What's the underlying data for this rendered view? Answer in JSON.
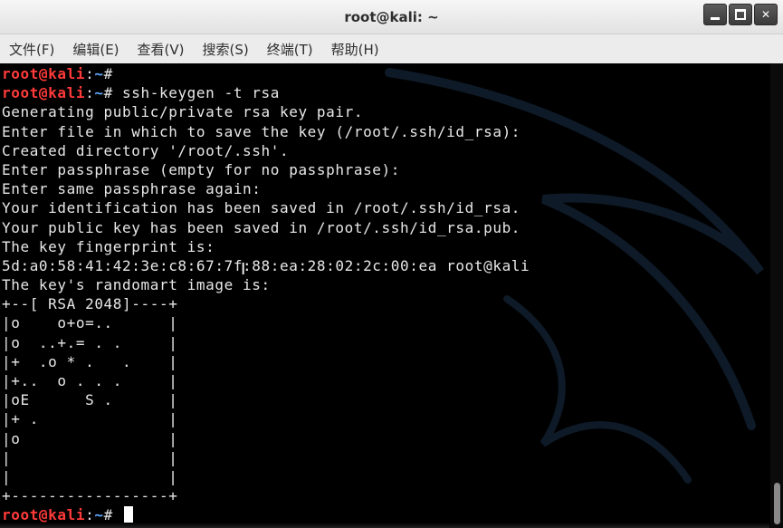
{
  "window": {
    "title": "root@kali: ~"
  },
  "menu": [
    "文件(F)",
    "编辑(E)",
    "查看(V)",
    "搜索(S)",
    "终端(T)",
    "帮助(H)"
  ],
  "prompt": {
    "user": "root@kali",
    "path": "~",
    "symbol": "#"
  },
  "terminal": {
    "lines": [
      {
        "type": "prompt",
        "cmd": ""
      },
      {
        "type": "prompt",
        "cmd": "ssh-keygen -t rsa"
      },
      {
        "type": "text",
        "text": "Generating public/private rsa key pair."
      },
      {
        "type": "text",
        "text": "Enter file in which to save the key (/root/.ssh/id_rsa):"
      },
      {
        "type": "text",
        "text": "Created directory '/root/.ssh'."
      },
      {
        "type": "text",
        "text": "Enter passphrase (empty for no passphrase):"
      },
      {
        "type": "text",
        "text": "Enter same passphrase again:"
      },
      {
        "type": "text",
        "text": "Your identification has been saved in /root/.ssh/id_rsa."
      },
      {
        "type": "text",
        "text": "Your public key has been saved in /root/.ssh/id_rsa.pub."
      },
      {
        "type": "text",
        "text": "The key fingerprint is:"
      },
      {
        "type": "text",
        "text": "5d:a0:58:41:42:3e:c8:67:7f:88:ea:28:02:2c:00:ea root@kali"
      },
      {
        "type": "text",
        "text": "The key's randomart image is:"
      },
      {
        "type": "text",
        "text": "+--[ RSA 2048]----+"
      },
      {
        "type": "text",
        "text": "|o    o+o=..      |"
      },
      {
        "type": "text",
        "text": "|o  ..+.= . .     |"
      },
      {
        "type": "text",
        "text": "|+  .o * .   .    |"
      },
      {
        "type": "text",
        "text": "|+..  o . . .     |"
      },
      {
        "type": "text",
        "text": "|oE      S .      |"
      },
      {
        "type": "text",
        "text": "|+ .              |"
      },
      {
        "type": "text",
        "text": "|o                |"
      },
      {
        "type": "text",
        "text": "|                 |"
      },
      {
        "type": "text",
        "text": "|                 |"
      },
      {
        "type": "text",
        "text": "+-----------------+"
      },
      {
        "type": "prompt",
        "cmd": "",
        "cursor": true
      }
    ]
  },
  "colors": {
    "prompt_user": "#ff3a3a",
    "prompt_path": "#5fa8ff",
    "text": "#e8e8e8",
    "background": "#000000"
  },
  "icons": {
    "minimize": "minimize-icon",
    "maximize": "maximize-icon",
    "close": "close-icon",
    "text_cursor": "ibeam-cursor-icon"
  }
}
